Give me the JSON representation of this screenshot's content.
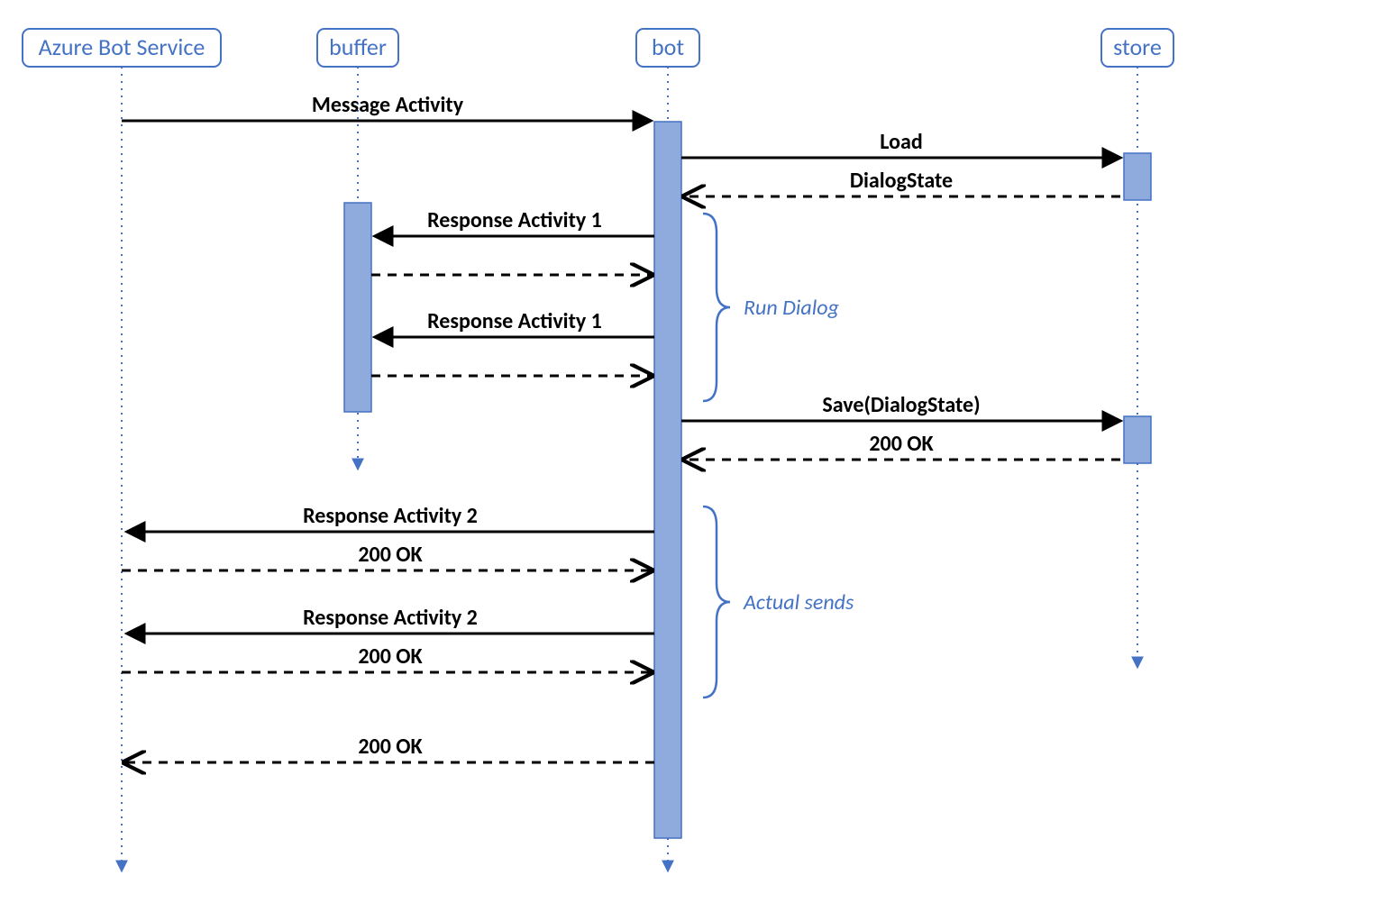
{
  "participants": {
    "azure": "Azure Bot Service",
    "buffer": "buffer",
    "bot": "bot",
    "store": "store"
  },
  "messages": {
    "msg_activity": "Message Activity",
    "load": "Load",
    "dialog_state": "DialogState",
    "resp1a": "Response Activity 1",
    "resp1b": "Response Activity 1",
    "save": "Save(DialogState)",
    "ok_save": "200 OK",
    "resp2a": "Response Activity 2",
    "ok2a": "200 OK",
    "resp2b": "Response Activity 2",
    "ok2b": "200 OK",
    "ok_final": "200 OK"
  },
  "annotations": {
    "run_dialog": "Run Dialog",
    "actual_sends": "Actual sends"
  },
  "colors": {
    "accent": "#4472c4",
    "activation": "#8faadc",
    "text": "#000000"
  }
}
